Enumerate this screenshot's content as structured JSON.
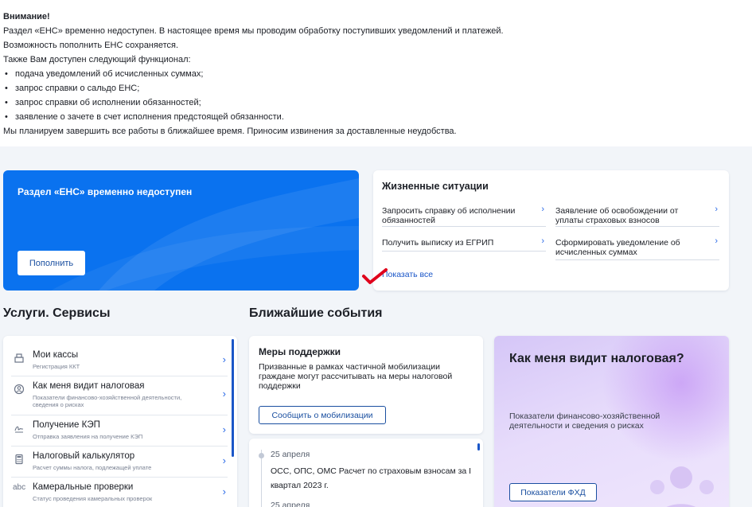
{
  "notice": {
    "title": "Внимание!",
    "line1": "Раздел «ЕНС» временно недоступен. В настоящее время мы проводим обработку поступивших уведомлений и платежей.",
    "line2": "Возможность пополнить ЕНС сохраняется.",
    "line3": "Также Вам доступен следующий функционал:",
    "bullets": [
      "подача уведомлений об исчисленных суммах;",
      "запрос справки о сальдо ЕНС;",
      "запрос справки об исполнении обязанностей;",
      "заявление о зачете в счет исполнения предстоящей обязанности."
    ],
    "line4": "Мы планируем завершить все работы в ближайшее время. Приносим извинения за доставленные неудобства."
  },
  "banner": {
    "title": "Раздел «ЕНС» временно недоступен",
    "button": "Пополнить"
  },
  "life": {
    "title": "Жизненные ситуации",
    "links": [
      "Запросить справку об исполнении обязанностей",
      "Заявление об освобождении от уплаты страховых взносов",
      "Получить выписку из ЕГРИП",
      "Сформировать уведомление об исчисленных суммах"
    ],
    "show_all": "Показать все"
  },
  "sections": {
    "services": "Услуги. Сервисы",
    "events": "Ближайшие события"
  },
  "services": [
    {
      "name": "Мои кассы",
      "desc": "Регистрация ККТ",
      "icon": "cash-register-icon"
    },
    {
      "name": "Как меня видит налоговая",
      "desc": "Показатели финансово-хозяйственной деятельности, сведения о рисках",
      "icon": "user-search-icon"
    },
    {
      "name": "Получение КЭП",
      "desc": "Отправка заявления на получение КЭП",
      "icon": "signature-icon"
    },
    {
      "name": "Налоговый калькулятор",
      "desc": "Расчет суммы налога, подлежащей уплате",
      "icon": "calculator-icon"
    },
    {
      "name": "Камеральные проверки",
      "desc": "Статус проведения камеральных проверок",
      "icon": "abc-icon"
    }
  ],
  "support": {
    "title": "Меры поддержки",
    "text": "Призванные в рамках частичной мобилизации граждане могут рассчитывать на меры налоговой поддержки",
    "button": "Сообщить о мобилизации"
  },
  "events": {
    "date1": "25 апреля",
    "text1": "ОСС, ОПС, ОМС Расчет по страховым взносам за I квартал 2023 г.",
    "date2": "25 апреля"
  },
  "tax": {
    "title": "Как меня видит налоговая?",
    "text": "Показатели финансово-хозяйственной деятельности и сведения о рисках",
    "button": "Показатели ФХД"
  },
  "colors": {
    "accent": "#0a72ef",
    "link": "#1a56c8",
    "checkmark": "#e0001b",
    "tax_card": "#e3d6fb"
  }
}
